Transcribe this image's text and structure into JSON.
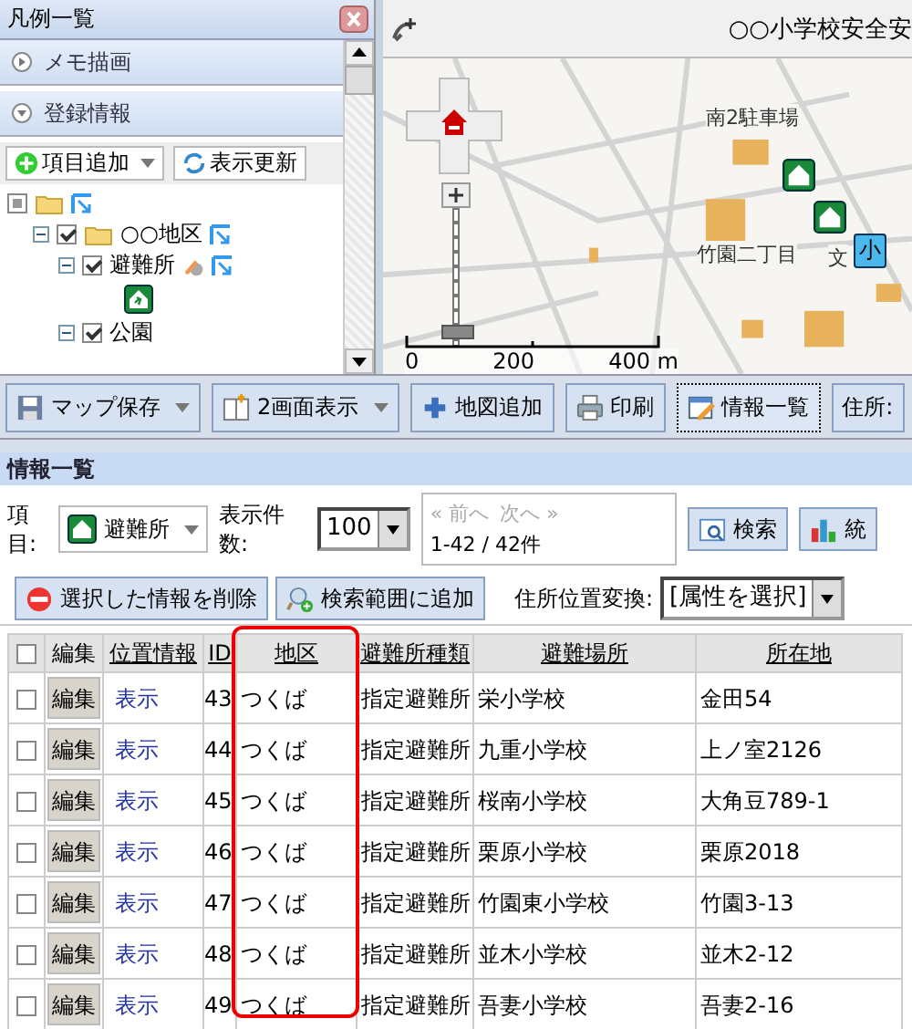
{
  "legend_panel": {
    "title": "凡例一覧",
    "sections": [
      {
        "label": "メモ描画",
        "expanded": false
      },
      {
        "label": "登録情報",
        "expanded": true
      }
    ],
    "buttons": [
      {
        "label": "項目追加",
        "kind": "add"
      },
      {
        "label": "表示更新",
        "kind": "refresh"
      }
    ],
    "tree": [
      {
        "checked": false,
        "indeterminate": true,
        "children": [
          {
            "label": "○○地区",
            "checked": true,
            "indeterminate": false,
            "expanded": true,
            "children": [
              {
                "label": "避難所",
                "checked": true,
                "indeterminate": false,
                "expanded": true
              },
              {
                "label": "公園",
                "checked": true,
                "indeterminate": false,
                "expanded": true
              }
            ]
          }
        ]
      }
    ]
  },
  "map": {
    "title": "○○小学校安全安",
    "labels": [
      "南2駐車場",
      "竹園二丁目",
      "文"
    ],
    "school_marker": "小",
    "scale_labels": [
      "0",
      "200",
      "400 m"
    ],
    "zoom": {
      "level": 0.05
    }
  },
  "toolbar": [
    {
      "label": "マップ保存",
      "kind": "save",
      "dropdown": true,
      "selected": false
    },
    {
      "label": "2画面表示",
      "kind": "split",
      "dropdown": true,
      "selected": false
    },
    {
      "label": "地図追加",
      "kind": "add",
      "dropdown": false,
      "selected": false
    },
    {
      "label": "印刷",
      "kind": "print",
      "dropdown": false,
      "selected": false
    },
    {
      "label": "情報一覧",
      "kind": "list",
      "dropdown": false,
      "selected": true
    },
    {
      "label": "住所:",
      "kind": "text",
      "dropdown": false,
      "selected": false
    }
  ],
  "info_panel": {
    "title": "情報一覧",
    "item_label": "項目:",
    "item_select": "避難所",
    "count_label": "表示件数:",
    "count_select": "100",
    "pager": {
      "prev": "« 前へ",
      "next": "次へ »",
      "range": "1-42 / 42件"
    },
    "search_button": "検索",
    "stats_button": "統",
    "delete_button": "選択した情報を削除",
    "add_range_button": "検索範囲に追加",
    "address_label": "住所位置変換:",
    "address_select": "[属性を選択]",
    "table": {
      "select_all_checked": false,
      "columns": [
        {
          "label": "編集",
          "link": false,
          "highlighted": false
        },
        {
          "label": "位置情報",
          "link": true,
          "highlighted": false
        },
        {
          "label": "ID",
          "link": true,
          "highlighted": false
        },
        {
          "label": "地区",
          "link": true,
          "highlighted": true
        },
        {
          "label": "避難所種類",
          "link": true,
          "highlighted": false
        },
        {
          "label": "避難場所",
          "link": true,
          "highlighted": false
        },
        {
          "label": "所在地",
          "link": true,
          "highlighted": false
        }
      ],
      "rows": [
        {
          "checked": false,
          "cells": [
            "編集",
            "表示",
            "43",
            "つくば",
            "指定避難所",
            "栄小学校",
            "金田54"
          ]
        },
        {
          "checked": false,
          "cells": [
            "編集",
            "表示",
            "44",
            "つくば",
            "指定避難所",
            "九重小学校",
            "上ノ室2126"
          ]
        },
        {
          "checked": false,
          "cells": [
            "編集",
            "表示",
            "45",
            "つくば",
            "指定避難所",
            "桜南小学校",
            "大角豆789-1"
          ]
        },
        {
          "checked": false,
          "cells": [
            "編集",
            "表示",
            "46",
            "つくば",
            "指定避難所",
            "栗原小学校",
            "栗原2018"
          ]
        },
        {
          "checked": false,
          "cells": [
            "編集",
            "表示",
            "47",
            "つくば",
            "指定避難所",
            "竹園東小学校",
            "竹園3-13"
          ]
        },
        {
          "checked": false,
          "cells": [
            "編集",
            "表示",
            "48",
            "つくば",
            "指定避難所",
            "並木小学校",
            "並木2-12"
          ]
        },
        {
          "checked": false,
          "cells": [
            "編集",
            "表示",
            "49",
            "つくば",
            "指定避難所",
            "吾妻小学校",
            "吾妻2-16"
          ]
        }
      ]
    }
  }
}
